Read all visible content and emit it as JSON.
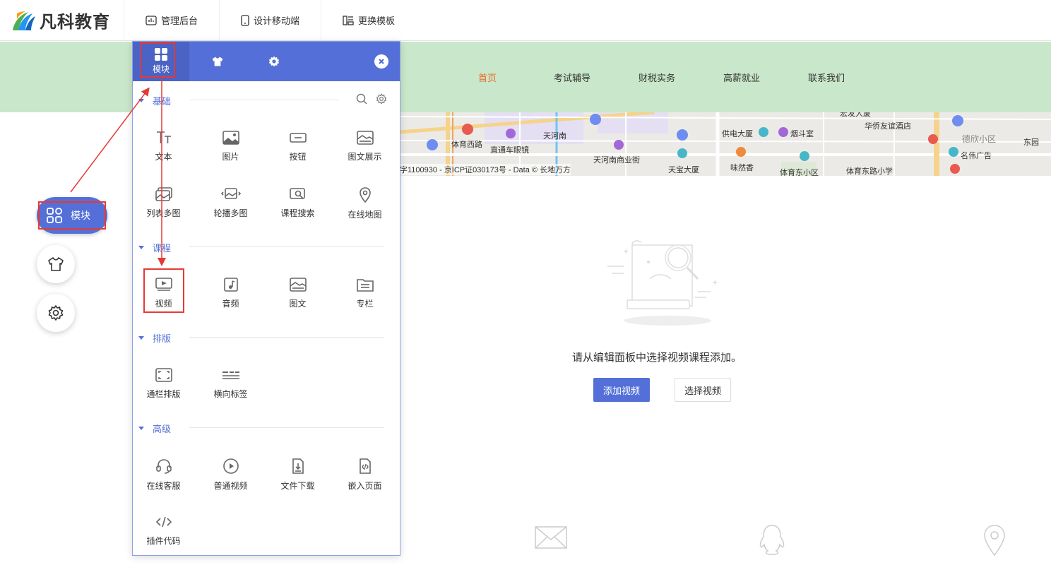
{
  "brand": {
    "name": "凡科教育"
  },
  "topbar": {
    "items": [
      {
        "label": "管理后台",
        "icon": "chart-icon"
      },
      {
        "label": "设计移动端",
        "icon": "mobile-icon"
      },
      {
        "label": "更换模板",
        "icon": "template-icon"
      }
    ]
  },
  "site_nav": {
    "items": [
      "首页",
      "考试辅导",
      "财税实务",
      "高薪就业",
      "联系我们"
    ],
    "active_index": 0,
    "active_color": "#e8692a",
    "background": "#c9e7ca"
  },
  "map": {
    "labels": [
      "体育西路",
      "直通车眼镜",
      "天河南",
      "天河南商业街",
      "天宝大厦",
      "供电大厦",
      "烟斗室",
      "味然香",
      "体育东小区",
      "体育东路小学",
      "华侨友谊酒店",
      "德欣小区",
      "名伟广告",
      "东园",
      "宏发大厦"
    ],
    "copyright": "字1100930 - 京ICP证030173号 - Data © 长地万方"
  },
  "empty_state": {
    "message": "请从编辑面板中选择视频课程添加。",
    "primary_button": "添加视频",
    "secondary_button": "选择视频"
  },
  "float_nav": {
    "modules_label": "模块",
    "accent": "#5470d8"
  },
  "panel": {
    "tabs": [
      {
        "label": "模块",
        "icon": "grid-icon",
        "active": true
      },
      {
        "label": "",
        "icon": "shirt-icon",
        "active": false
      },
      {
        "label": "",
        "icon": "gear-icon",
        "active": false
      }
    ],
    "sections": [
      {
        "title": "基础",
        "items": [
          {
            "label": "文本",
            "icon": "text-icon"
          },
          {
            "label": "图片",
            "icon": "image-icon"
          },
          {
            "label": "按钮",
            "icon": "button-icon"
          },
          {
            "label": "图文展示",
            "icon": "image-text-icon"
          },
          {
            "label": "列表多图",
            "icon": "list-images-icon"
          },
          {
            "label": "轮播多图",
            "icon": "carousel-icon"
          },
          {
            "label": "课程搜索",
            "icon": "course-search-icon"
          },
          {
            "label": "在线地图",
            "icon": "map-pin-icon"
          }
        ]
      },
      {
        "title": "课程",
        "items": [
          {
            "label": "视频",
            "icon": "video-icon"
          },
          {
            "label": "音频",
            "icon": "audio-icon"
          },
          {
            "label": "图文",
            "icon": "image-text-icon"
          },
          {
            "label": "专栏",
            "icon": "column-icon"
          }
        ]
      },
      {
        "title": "排版",
        "items": [
          {
            "label": "通栏排版",
            "icon": "fullwidth-icon"
          },
          {
            "label": "横向标签",
            "icon": "horizontal-tabs-icon"
          }
        ]
      },
      {
        "title": "高级",
        "items": [
          {
            "label": "在线客服",
            "icon": "headset-icon"
          },
          {
            "label": "普通视频",
            "icon": "play-circle-icon"
          },
          {
            "label": "文件下载",
            "icon": "file-download-icon"
          },
          {
            "label": "嵌入页面",
            "icon": "embed-page-icon"
          },
          {
            "label": "插件代码",
            "icon": "code-icon"
          }
        ]
      }
    ]
  },
  "annotation_color": "#e53935"
}
